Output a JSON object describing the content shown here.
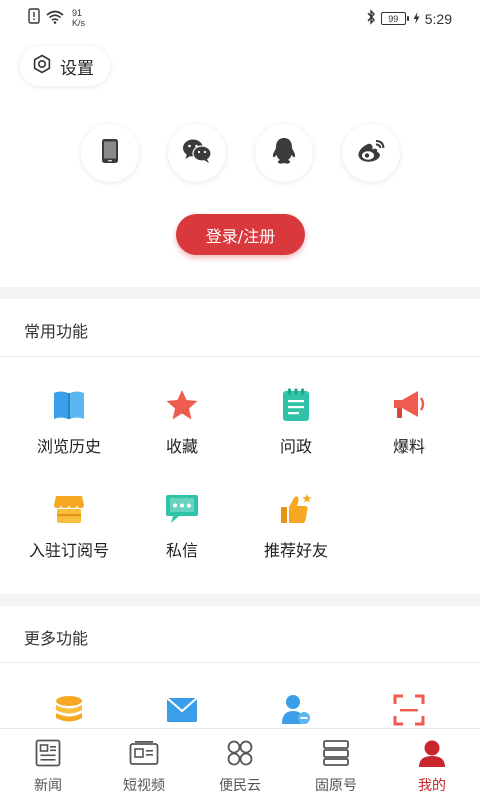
{
  "status_bar": {
    "net_speed_value": "91",
    "net_speed_unit": "K/s",
    "battery": "99",
    "time": "5:29",
    "icons": [
      "alert-sim-icon",
      "wifi-icon",
      "bluetooth-icon",
      "battery-icon",
      "charging-icon"
    ]
  },
  "settings": {
    "label": "设置",
    "icon": "gear-icon"
  },
  "social_logins": [
    {
      "name": "phone",
      "icon": "phone-icon"
    },
    {
      "name": "wechat",
      "icon": "wechat-icon"
    },
    {
      "name": "qq",
      "icon": "qq-icon"
    },
    {
      "name": "weibo",
      "icon": "weibo-icon"
    }
  ],
  "login_button": {
    "label": "登录/注册",
    "color": "#d9393d"
  },
  "common_functions": {
    "title": "常用功能",
    "items": [
      {
        "label": "浏览历史",
        "icon": "book-icon",
        "color": "#3a9ee8"
      },
      {
        "label": "收藏",
        "icon": "star-icon",
        "color": "#ef5b4f"
      },
      {
        "label": "问政",
        "icon": "notepad-icon",
        "color": "#2fc4a8"
      },
      {
        "label": "爆料",
        "icon": "megaphone-icon",
        "color": "#ef5b4f"
      },
      {
        "label": "入驻订阅号",
        "icon": "store-icon",
        "color": "#f7a823"
      },
      {
        "label": "私信",
        "icon": "chat-icon",
        "color": "#2fc4a8"
      },
      {
        "label": "推荐好友",
        "icon": "thumbs-up-icon",
        "color": "#f7a823"
      }
    ]
  },
  "more_functions": {
    "title": "更多功能",
    "items": [
      {
        "icon": "coins-icon",
        "color": "#f7a823"
      },
      {
        "icon": "mail-icon",
        "color": "#3a9ee8"
      },
      {
        "icon": "user-minus-icon",
        "color": "#3a9ee8"
      },
      {
        "icon": "scan-icon",
        "color": "#ef5b4f"
      }
    ]
  },
  "bottom_nav": {
    "items": [
      {
        "label": "新闻",
        "icon": "news-icon",
        "active": false
      },
      {
        "label": "短视频",
        "icon": "video-icon",
        "active": false
      },
      {
        "label": "便民云",
        "icon": "apps-icon",
        "active": false
      },
      {
        "label": "固原号",
        "icon": "layers-icon",
        "active": false
      },
      {
        "label": "我的",
        "icon": "user-icon",
        "active": true
      }
    ],
    "active_color": "#c8262a"
  }
}
